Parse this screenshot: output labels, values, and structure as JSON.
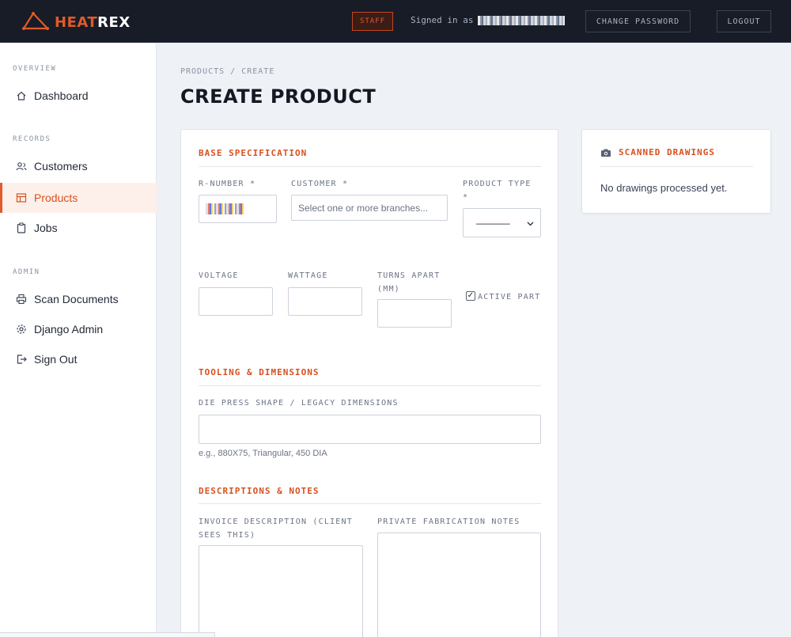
{
  "app": {
    "brand_part1": "HEAT",
    "brand_part2": "REX",
    "colors": {
      "accent": "#e05a2b",
      "topbar": "#171c27",
      "page_bg": "#eef1f5",
      "card_bg": "#ffffff"
    }
  },
  "topbar": {
    "staff_badge": "STAFF",
    "signed_in_prefix": "Signed in as",
    "change_password": "CHANGE PASSWORD",
    "logout": "LOGOUT"
  },
  "sidebar": {
    "sections": [
      {
        "title": "OVERVIEW",
        "items": [
          {
            "label": "Dashboard",
            "icon": "home-icon"
          }
        ]
      },
      {
        "title": "RECORDS",
        "items": [
          {
            "label": "Customers",
            "icon": "users-icon"
          },
          {
            "label": "Products",
            "icon": "table-icon",
            "active": true
          },
          {
            "label": "Jobs",
            "icon": "clipboard-icon"
          }
        ]
      },
      {
        "title": "ADMIN",
        "items": [
          {
            "label": "Scan Documents",
            "icon": "printer-icon"
          },
          {
            "label": "Django Admin",
            "icon": "gear-icon"
          },
          {
            "label": "Sign Out",
            "icon": "sign-out-icon"
          }
        ]
      }
    ]
  },
  "main": {
    "breadcrumb": "PRODUCTS / CREATE",
    "title": "CREATE PRODUCT",
    "form": {
      "base_spec_title": "BASE SPECIFICATION",
      "r_number_label": "R-NUMBER *",
      "customer_label": "CUSTOMER *",
      "customer_placeholder": "Select one or more branches...",
      "product_type_label_1": "PRODUCT TYPE",
      "product_type_label_2": "*",
      "product_type_value": "———–",
      "voltage_label": "VOLTAGE",
      "wattage_label": "WATTAGE",
      "turns_apart_label_1": "TURNS APART",
      "turns_apart_label_2": "(MM)",
      "active_part_label": "ACTIVE PART",
      "active_part_checked": true,
      "tooling_title": "TOOLING & DIMENSIONS",
      "die_press_label": "DIE PRESS SHAPE / LEGACY DIMENSIONS",
      "die_press_helper": "e.g., 880X75, Triangular, 450 DIA",
      "descriptions_title": "DESCRIPTIONS & NOTES",
      "invoice_label_1": "INVOICE DESCRIPTION (CLIENT",
      "invoice_label_2": "SEES THIS)",
      "private_notes_label": "PRIVATE FABRICATION NOTES"
    }
  },
  "side_panel": {
    "title": "SCANNED DRAWINGS",
    "icon": "camera-icon",
    "empty_text": "No drawings processed yet."
  }
}
